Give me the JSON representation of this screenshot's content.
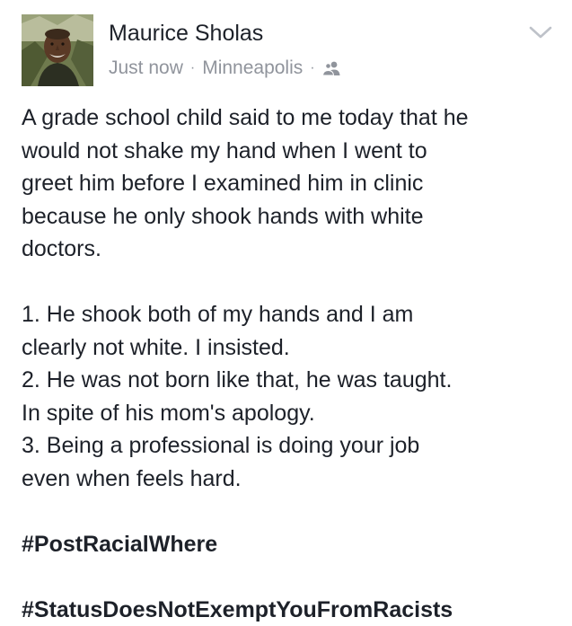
{
  "post": {
    "author": "Maurice Sholas",
    "timestamp": "Just now",
    "location": "Minneapolis",
    "separator": "·",
    "audience_icon": "friends-icon",
    "menu_icon": "chevron-down-icon",
    "body": {
      "intro_lines": [
        "A grade school child said to me today that he",
        "would not shake my hand when I went to",
        "greet him before I examined him in clinic",
        "because he only shook hands with white",
        "doctors."
      ],
      "list_lines": [
        "1.  He shook both of my hands and I am",
        "clearly not white.   I insisted.",
        "2.  He was not born like that, he was taught.",
        "In spite of his mom's apology.",
        "3.   Being a professional is doing your job",
        "even when feels hard."
      ],
      "hashtags": [
        "#PostRacialWhere",
        "#StatusDoesNotExemptYouFromRacists"
      ]
    }
  },
  "colors": {
    "text": "#1d2129",
    "meta": "#90949c",
    "chevron": "#bec2c9"
  }
}
